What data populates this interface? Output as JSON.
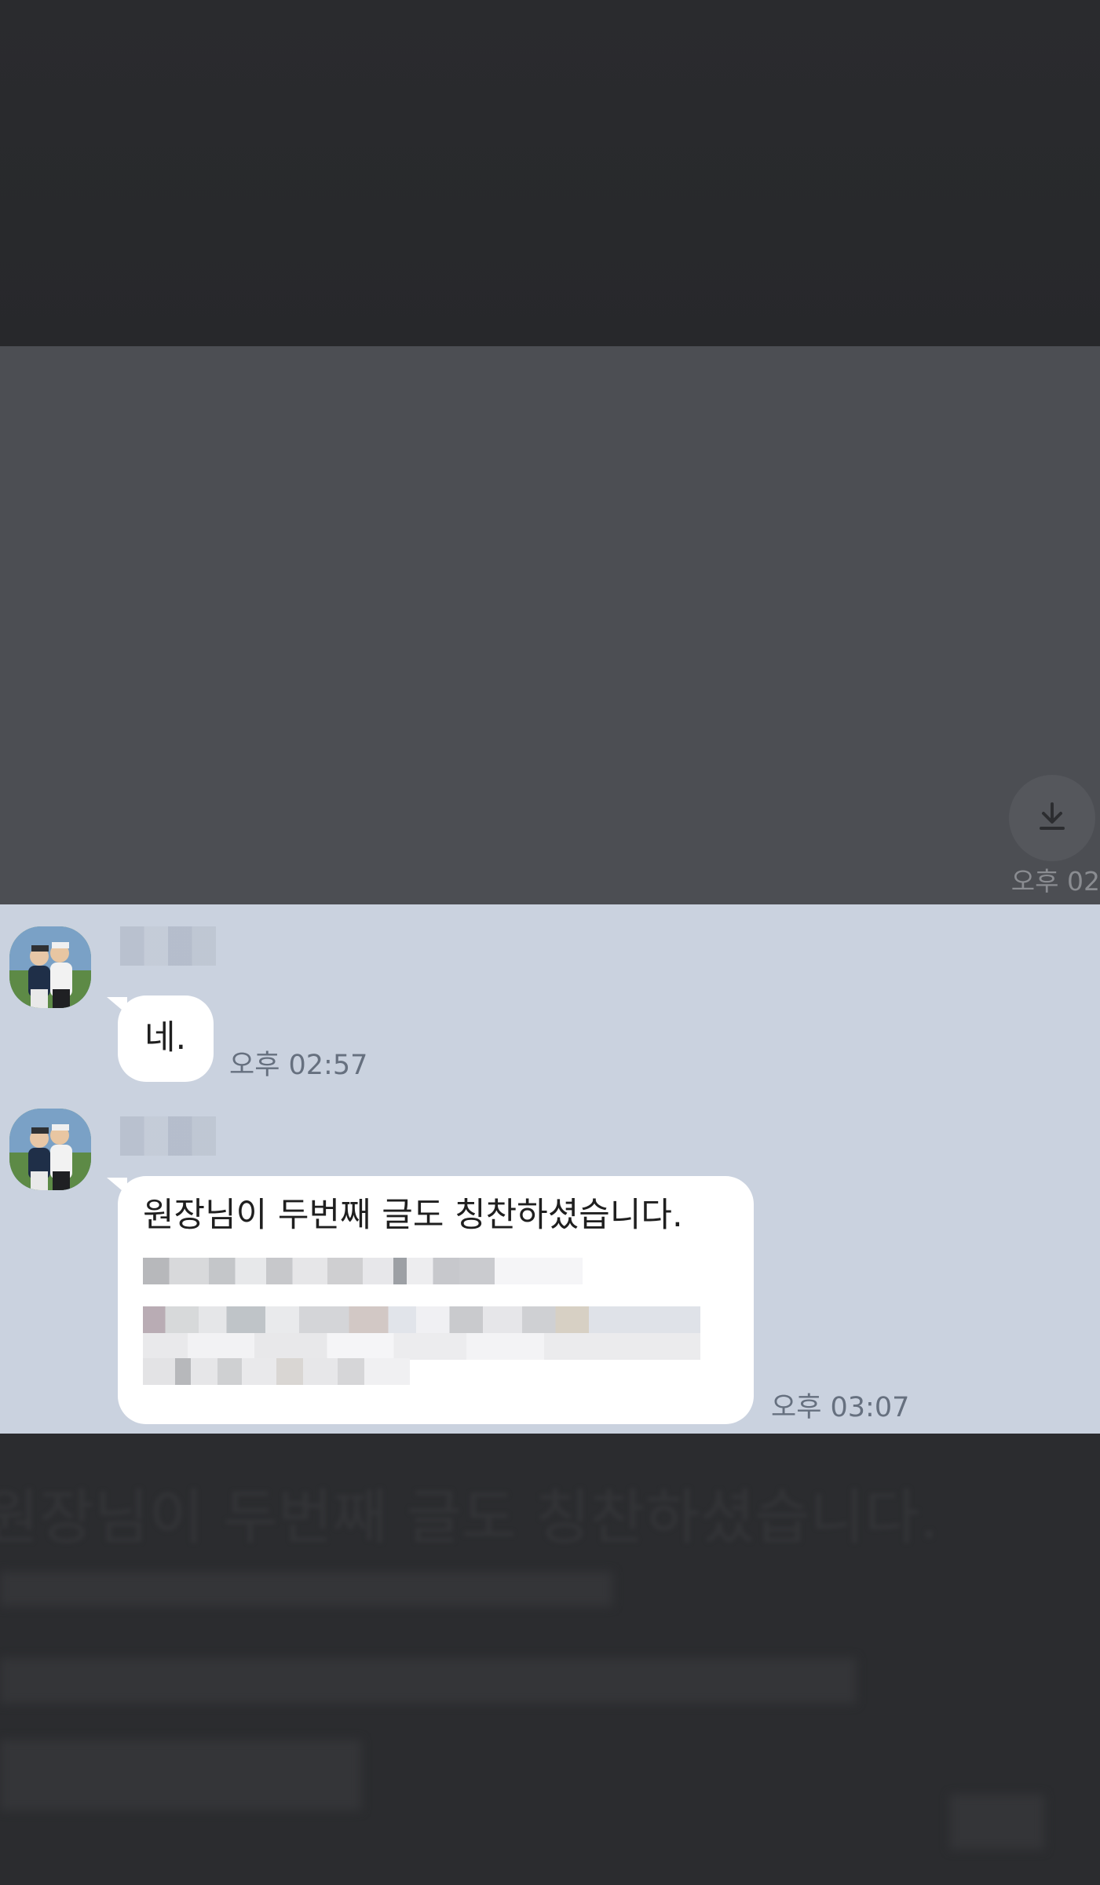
{
  "image_message": {
    "time": "오후 02",
    "download_icon": "download-icon"
  },
  "messages": [
    {
      "sender_redacted": true,
      "text": "네.",
      "time": "오후 02:57",
      "avatar_icon": "avatar-photo"
    },
    {
      "sender_redacted": true,
      "text": "원장님이 두번째 글도 칭찬하셨습니다.",
      "time": "오후 03:07",
      "avatar_icon": "avatar-photo",
      "redacted_lines": 3
    }
  ],
  "background_preview": {
    "text": "원장님이 두번째 글도 칭찬하셨습니다."
  },
  "colors": {
    "image_band": "#4c4e53",
    "chat_background": "#cad2df",
    "bubble": "#ffffff",
    "dark_background": "#2a2b2e"
  }
}
